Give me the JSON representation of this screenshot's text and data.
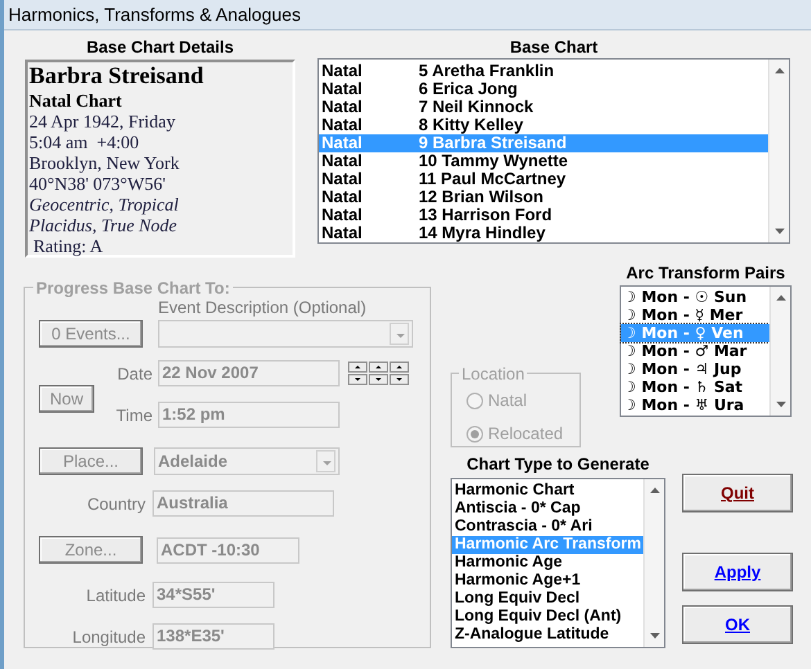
{
  "window": {
    "title": "Harmonics, Transforms & Analogues"
  },
  "base_chart_details": {
    "heading": "Base Chart Details",
    "name": "Barbra Streisand",
    "chart_kind": "Natal Chart",
    "date": "24 Apr 1942, Friday",
    "time": "5:04 am  +4:00",
    "place": "Brooklyn, New York",
    "coordinates": "40°N38' 073°W56'",
    "system": "Geocentric, Tropical",
    "houses": "Placidus, True Node",
    "rating": "Rating: A"
  },
  "base_chart": {
    "heading": "Base Chart",
    "rows": [
      {
        "type": "Natal",
        "name": "5 Aretha Franklin",
        "selected": false
      },
      {
        "type": "Natal",
        "name": "6 Erica Jong",
        "selected": false
      },
      {
        "type": "Natal",
        "name": "7 Neil Kinnock",
        "selected": false
      },
      {
        "type": "Natal",
        "name": "8 Kitty Kelley",
        "selected": false
      },
      {
        "type": "Natal",
        "name": "9 Barbra Streisand",
        "selected": true
      },
      {
        "type": "Natal",
        "name": "10 Tammy Wynette",
        "selected": false
      },
      {
        "type": "Natal",
        "name": "11 Paul McCartney",
        "selected": false
      },
      {
        "type": "Natal",
        "name": "12 Brian Wilson",
        "selected": false
      },
      {
        "type": "Natal",
        "name": "13 Harrison Ford",
        "selected": false
      },
      {
        "type": "Natal",
        "name": "14 Myra Hindley",
        "selected": false
      }
    ]
  },
  "progress": {
    "title": "Progress Base Chart To:",
    "disabled": true,
    "events_button": "0 Events...",
    "event_description_label": "Event Description (Optional)",
    "now_button": "Now",
    "date_label": "Date",
    "date": "22 Nov 2007",
    "time_label": "Time",
    "time": "1:52 pm",
    "place_button": "Place...",
    "place": "Adelaide",
    "country_label": "Country",
    "country": "Australia",
    "zone_button": "Zone...",
    "zone": "ACDT -10:30",
    "latitude_label": "Latitude",
    "latitude": "34*S55'",
    "longitude_label": "Longitude",
    "longitude": "138*E35'"
  },
  "location": {
    "title": "Location",
    "disabled": true,
    "options": [
      {
        "label": "Natal",
        "selected": false
      },
      {
        "label": "Relocated",
        "selected": true
      }
    ]
  },
  "arc_transform_pairs": {
    "heading": "Arc Transform Pairs",
    "items": [
      {
        "label": "☽ Mon - ☉ Sun",
        "selected": false
      },
      {
        "label": "☽ Mon - ☿ Mer",
        "selected": false
      },
      {
        "label": "☽ Mon - ♀ Ven",
        "selected": true
      },
      {
        "label": "☽ Mon - ♂ Mar",
        "selected": false
      },
      {
        "label": "☽ Mon - ♃ Jup",
        "selected": false
      },
      {
        "label": "☽ Mon - ♄ Sat",
        "selected": false
      },
      {
        "label": "☽ Mon - ♅ Ura",
        "selected": false
      }
    ]
  },
  "chart_type": {
    "heading": "Chart Type to Generate",
    "items": [
      {
        "label": "Harmonic Chart",
        "selected": false
      },
      {
        "label": "Antiscia - 0* Cap",
        "selected": false
      },
      {
        "label": "Contrascia - 0* Ari",
        "selected": false
      },
      {
        "label": "Harmonic Arc Transform",
        "selected": true
      },
      {
        "label": "Harmonic Age",
        "selected": false
      },
      {
        "label": "Harmonic Age+1",
        "selected": false
      },
      {
        "label": "Long Equiv Decl",
        "selected": false
      },
      {
        "label": "Long Equiv Decl (Ant)",
        "selected": false
      },
      {
        "label": "Z-Analogue Latitude",
        "selected": false
      }
    ]
  },
  "buttons": [
    {
      "label": "Quit",
      "kind": "quit"
    },
    {
      "label": "Apply",
      "kind": "apply"
    },
    {
      "label": "OK",
      "kind": "ok"
    }
  ]
}
